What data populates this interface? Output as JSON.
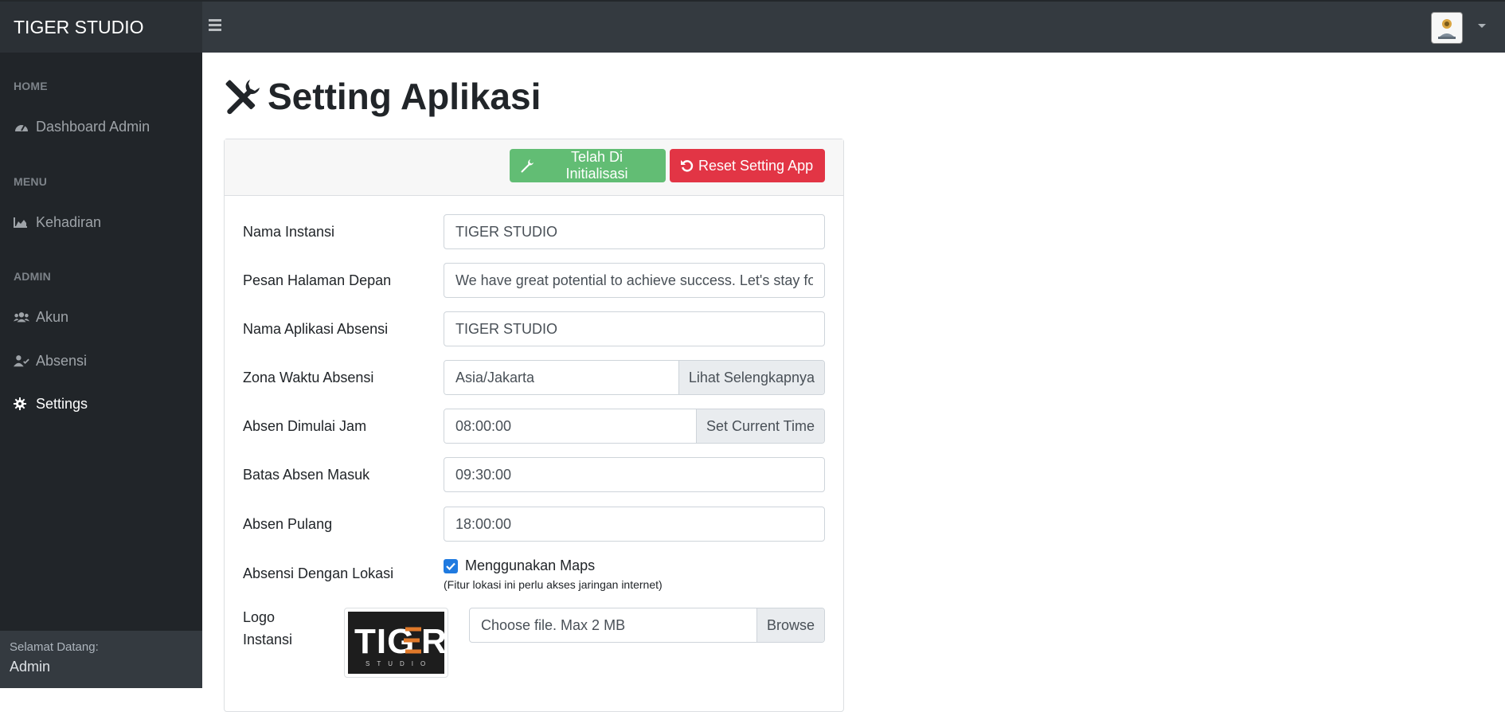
{
  "app": {
    "brand": "TIGER STUDIO"
  },
  "topbar": {
    "menu_icon": "bars-icon",
    "avatar_icon": "user-avatar-icon",
    "dropdown_icon": "caret-down-icon"
  },
  "sidebar": {
    "sections": [
      {
        "heading": "HOME",
        "items": [
          {
            "label": "Dashboard Admin",
            "icon": "tachometer-icon",
            "active": false
          }
        ]
      },
      {
        "heading": "MENU",
        "items": [
          {
            "label": "Kehadiran",
            "icon": "area-chart-icon",
            "active": false
          }
        ]
      },
      {
        "heading": "ADMIN",
        "items": [
          {
            "label": "Akun",
            "icon": "users-icon",
            "active": false
          },
          {
            "label": "Absensi",
            "icon": "user-check-icon",
            "active": false
          },
          {
            "label": "Settings",
            "icon": "gear-icon",
            "active": true
          }
        ]
      }
    ],
    "footer": {
      "greeting": "Selamat Datang:",
      "user": "Admin"
    }
  },
  "page": {
    "title": "Setting Aplikasi",
    "title_icon": "tools-icon"
  },
  "toolbar": {
    "init_label": "Telah Di Initialisasi",
    "reset_label": "Reset Setting App"
  },
  "form": {
    "nama_instansi": {
      "label": "Nama Instansi",
      "value": "TIGER STUDIO"
    },
    "pesan": {
      "label": "Pesan Halaman Depan",
      "value": "We have great potential to achieve success. Let's stay focused"
    },
    "nama_aplikasi": {
      "label": "Nama Aplikasi Absensi",
      "value": "TIGER STUDIO"
    },
    "zona": {
      "label": "Zona Waktu Absensi",
      "value": "Asia/Jakarta",
      "addon": "Lihat Selengkapnya"
    },
    "mulai": {
      "label": "Absen Dimulai Jam",
      "value": "08:00:00",
      "addon": "Set Current Time"
    },
    "batas": {
      "label": "Batas Absen Masuk",
      "value": "09:30:00"
    },
    "pulang": {
      "label": "Absen Pulang",
      "value": "18:00:00"
    },
    "lokasi": {
      "label": "Absensi Dengan Lokasi",
      "checkbox_label": "Menggunakan Maps",
      "checked": true,
      "note": "(Fitur lokasi ini perlu akses jaringan internet)"
    },
    "logo": {
      "label_line1": "Logo",
      "label_line2": "Instansi",
      "logo_text": "TIGER",
      "logo_subtext": "STUDIO",
      "file_placeholder": "Choose file. Max 2 MB",
      "browse_label": "Browse"
    }
  },
  "colors": {
    "topbar": "#343a40",
    "sidebar": "#212529",
    "success": "#62bd74",
    "danger": "#e23545",
    "primary": "#1f7ae0",
    "logo_accent": "#e0792a"
  }
}
